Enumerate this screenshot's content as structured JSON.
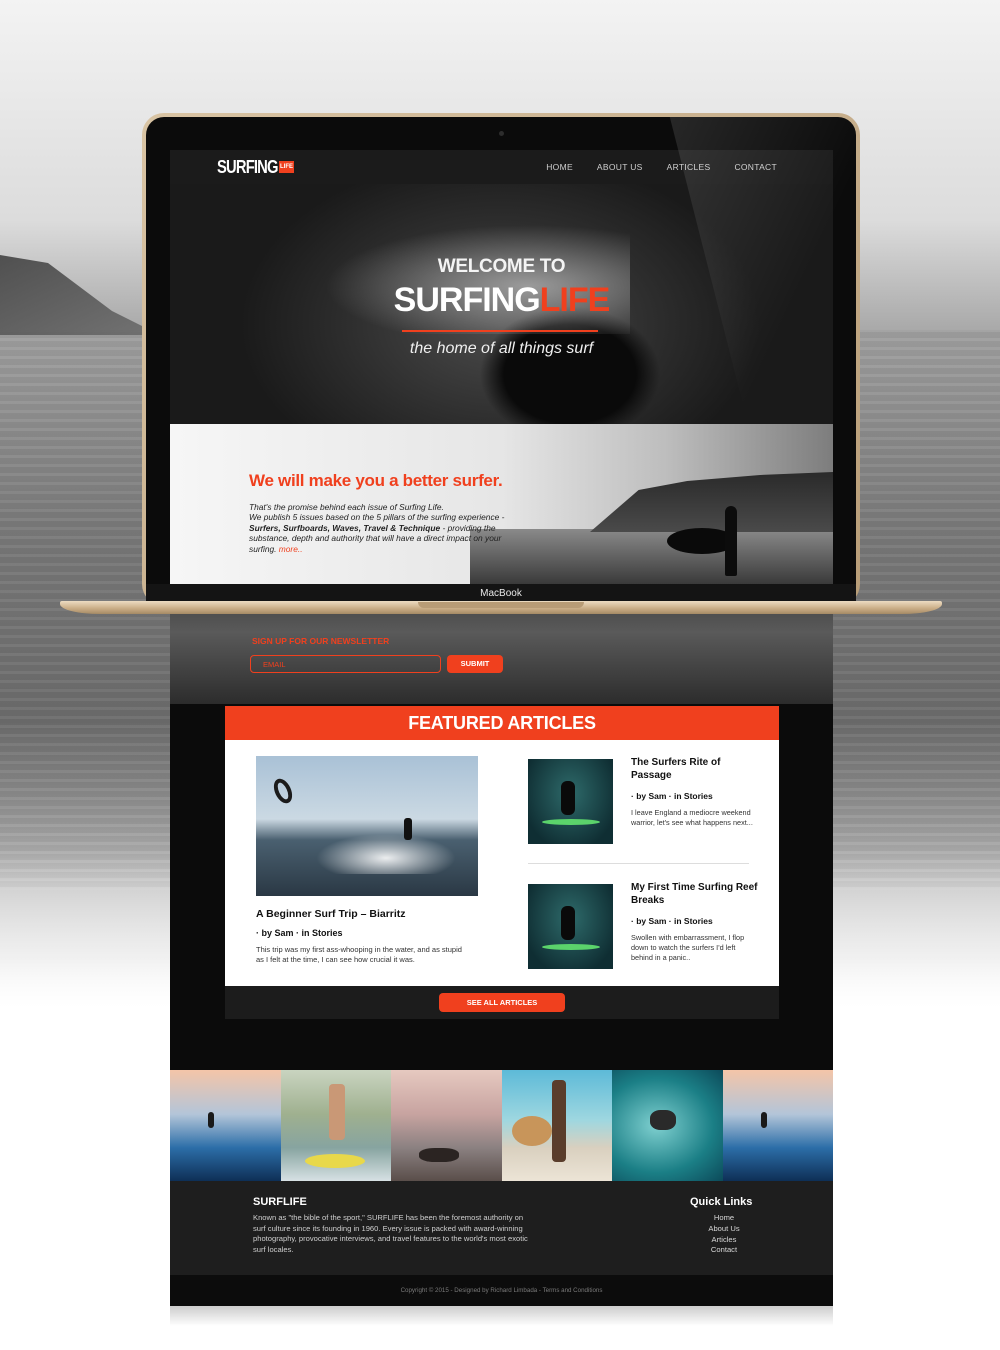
{
  "macbook_label": "MacBook",
  "nav": {
    "logo_text": "SURFING",
    "logo_badge": "LIFE",
    "links": [
      "HOME",
      "ABOUT US",
      "ARTICLES",
      "CONTACT"
    ]
  },
  "hero": {
    "welcome": "WELCOME TO",
    "brand_white": "SURFING",
    "brand_orange": "LIFE",
    "tagline": "the home of all things surf"
  },
  "promo": {
    "title": "We will make you a better surfer.",
    "text_1": "That's the promise behind each issue of Surfing Life.",
    "text_2": "We publish 5 issues based on the 5 pillars of the surfing experience - ",
    "text_bold": "Surfers, Surfboards, Waves, Travel & Technique",
    "text_3": " - providing the substance, depth and authority that will have a direct impact on your surfing. ",
    "more": "more.."
  },
  "newsletter": {
    "label": "SIGN UP FOR OUR NEWSLETTER",
    "email_placeholder": "EMAIL",
    "submit": "SUBMIT"
  },
  "featured": {
    "heading": "FEATURED ARTICLES",
    "main": {
      "title": "A Beginner Surf Trip – Biarritz",
      "meta": "· by Sam · in Stories",
      "excerpt": "This trip was my first ass-whooping in the water, and as stupid as I felt at the time, I can see how crucial it was."
    },
    "side": [
      {
        "title": "The Surfers Rite of Passage",
        "meta": "· by Sam · in Stories",
        "excerpt": "I leave England a mediocre weekend warrior, let's see what happens next..."
      },
      {
        "title": "My First Time Surfing Reef Breaks",
        "meta": "· by Sam · in Stories",
        "excerpt": "Swollen with embarrassment, I flop down to watch the surfers I'd left behind in a panic.."
      }
    ],
    "see_all": "SEE ALL ARTICLES"
  },
  "footer": {
    "brand": "SURFLIFE",
    "about": "Known as \"the bible of the sport,\" SURFLIFE has been the foremost authority on surf culture since its founding in 1960. Every issue is packed with award-winning photography, provocative interviews, and travel features to the world's most exotic surf locales.",
    "links_title": "Quick Links",
    "links": [
      "Home",
      "About Us",
      "Articles",
      "Contact"
    ],
    "copyright": "Copyright © 2015 - Designed by Richard Limbada - Terms and Conditions"
  },
  "colors": {
    "accent": "#f0401e",
    "dark": "#0d0d0d",
    "footer": "#1e1e1e"
  }
}
